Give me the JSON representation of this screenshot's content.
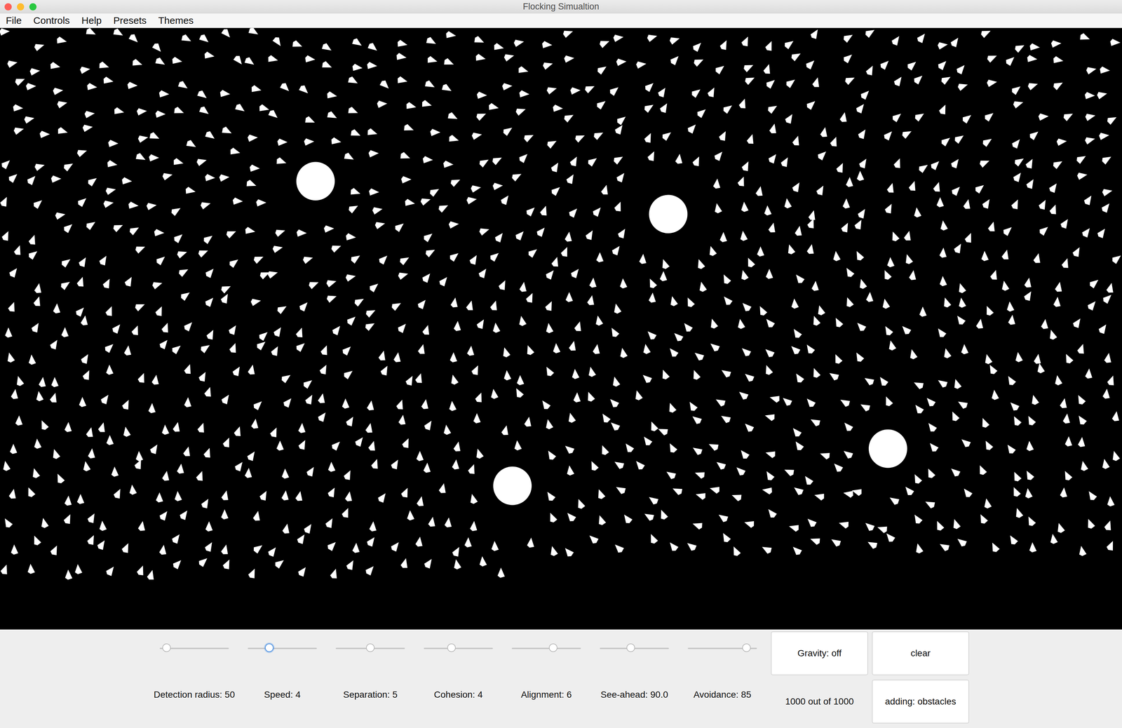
{
  "window": {
    "title": "Flocking Simualtion"
  },
  "menus": [
    {
      "label": "File"
    },
    {
      "label": "Controls"
    },
    {
      "label": "Help"
    },
    {
      "label": "Presets"
    },
    {
      "label": "Themes"
    }
  ],
  "flock": {
    "boids": 1000,
    "obstacles": 4
  },
  "sliders": [
    {
      "label": "Detection radius: 50",
      "level": 0.1,
      "focused": false
    },
    {
      "label": "Speed: 4",
      "level": 0.31,
      "focused": true
    },
    {
      "label": "Separation: 5",
      "level": 0.5,
      "focused": false
    },
    {
      "label": "Cohesion: 4",
      "level": 0.4,
      "focused": false
    },
    {
      "label": "Alignment: 6",
      "level": 0.6,
      "focused": false
    },
    {
      "label": "See-ahead: 90.0",
      "level": 0.45,
      "focused": false
    },
    {
      "label": "Avoidance: 85",
      "level": 0.85,
      "focused": false
    }
  ],
  "controls": [
    {
      "label": "Gravity: off",
      "kind": "button"
    },
    {
      "label": "clear",
      "kind": "button"
    },
    {
      "label": "1000 out of 1000",
      "kind": "counter"
    },
    {
      "label": "adding: obstacles",
      "kind": "button"
    }
  ]
}
